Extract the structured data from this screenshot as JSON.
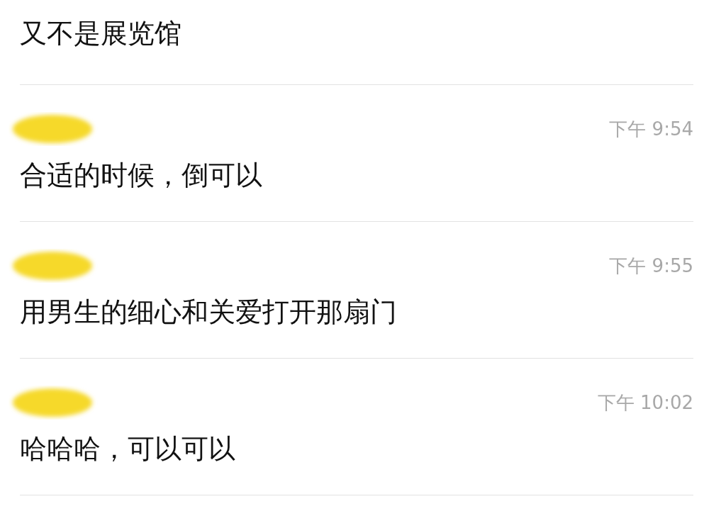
{
  "messages": [
    {
      "name_redacted": false,
      "text": "又不是展览馆"
    },
    {
      "name_redacted": true,
      "time": "下午 9:54",
      "text": "合适的时候，倒可以"
    },
    {
      "name_redacted": true,
      "time": "下午 9:55",
      "text": "用男生的细心和关爱打开那扇门"
    },
    {
      "name_redacted": true,
      "time": "下午 10:02",
      "text": "哈哈哈，可以可以"
    }
  ]
}
